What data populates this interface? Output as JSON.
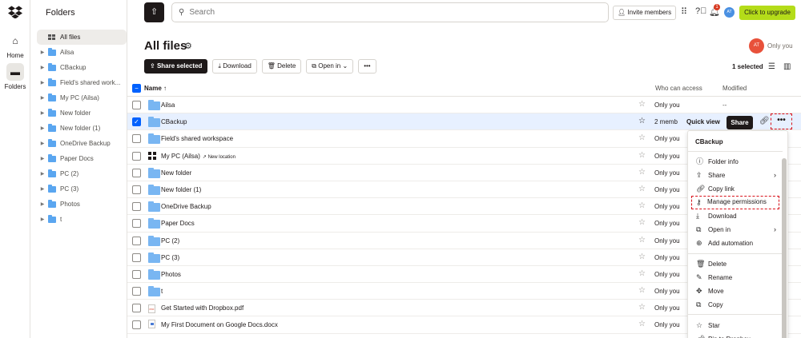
{
  "rail": {
    "items": [
      {
        "label": "Home"
      },
      {
        "label": "Folders"
      }
    ]
  },
  "folders_panel": {
    "title": "Folders",
    "items": [
      {
        "label": "All files"
      },
      {
        "label": "Ailsa"
      },
      {
        "label": "CBackup"
      },
      {
        "label": "Field's shared work..."
      },
      {
        "label": "My PC (Ailsa)"
      },
      {
        "label": "New folder"
      },
      {
        "label": "New folder (1)"
      },
      {
        "label": "OneDrive Backup"
      },
      {
        "label": "Paper Docs"
      },
      {
        "label": "PC (2)"
      },
      {
        "label": "PC (3)"
      },
      {
        "label": "Photos"
      },
      {
        "label": "t"
      }
    ]
  },
  "topbar": {
    "search_placeholder": "Search",
    "invite_label": "Invite members",
    "notification_count": "1",
    "avatar_initials": "AT",
    "upgrade_label": "Click to upgrade"
  },
  "header": {
    "title": "All files",
    "owner_initials": "AT",
    "owner_text": "Only you"
  },
  "actions": {
    "share_selected": "Share selected",
    "download": "Download",
    "delete": "Delete",
    "open_in": "Open in",
    "selected_count": "1 selected"
  },
  "table": {
    "columns": {
      "name": "Name",
      "access": "Who can access",
      "modified": "Modified"
    },
    "rows": [
      {
        "name": "Ailsa",
        "access": "Only you",
        "modified": "--",
        "type": "folder"
      },
      {
        "name": "CBackup",
        "access": "2 memb",
        "modified": "",
        "type": "folder-shared",
        "selected": true
      },
      {
        "name": "Field's shared workspace",
        "access": "Only you",
        "modified": "",
        "type": "folder-shared"
      },
      {
        "name": "My PC (Ailsa)",
        "access": "Only you",
        "modified": "",
        "type": "windows",
        "badge": "New location"
      },
      {
        "name": "New folder",
        "access": "Only you",
        "modified": "",
        "type": "folder"
      },
      {
        "name": "New folder (1)",
        "access": "Only you",
        "modified": "",
        "type": "folder"
      },
      {
        "name": "OneDrive Backup",
        "access": "Only you",
        "modified": "",
        "type": "folder"
      },
      {
        "name": "Paper Docs",
        "access": "Only you",
        "modified": "",
        "type": "folder"
      },
      {
        "name": "PC (2)",
        "access": "Only you",
        "modified": "",
        "type": "folder"
      },
      {
        "name": "PC (3)",
        "access": "Only you",
        "modified": "",
        "type": "folder"
      },
      {
        "name": "Photos",
        "access": "Only you",
        "modified": "",
        "type": "folder"
      },
      {
        "name": "t",
        "access": "Only you",
        "modified": "",
        "type": "folder"
      },
      {
        "name": "Get Started with Dropbox.pdf",
        "access": "Only you",
        "modified": "",
        "type": "pdf"
      },
      {
        "name": "My First Document on Google Docs.docx",
        "access": "Only you",
        "modified": "",
        "type": "gdoc"
      }
    ]
  },
  "row_actions": {
    "quick_view": "Quick view",
    "share": "Share",
    "more": "•••"
  },
  "context_menu": {
    "title": "CBackup",
    "items": [
      {
        "label": "Folder info",
        "icon": "info-icon"
      },
      {
        "label": "Share",
        "icon": "share-icon"
      },
      {
        "label": "Copy link",
        "icon": "link-icon"
      },
      {
        "label": "Manage permissions",
        "icon": "permissions-icon"
      },
      {
        "label": "Download",
        "icon": "download-icon"
      },
      {
        "label": "Open in",
        "icon": "open-in-icon"
      },
      {
        "label": "Add automation",
        "icon": "automation-icon"
      },
      {
        "label": "Delete",
        "icon": "trash-icon"
      },
      {
        "label": "Rename",
        "icon": "rename-icon"
      },
      {
        "label": "Move",
        "icon": "move-icon"
      },
      {
        "label": "Copy",
        "icon": "copy-icon"
      },
      {
        "label": "Star",
        "icon": "star-icon"
      },
      {
        "label": "Pin to Dropbox",
        "icon": "pin-icon"
      }
    ]
  },
  "colors": {
    "accent": "#0061fe",
    "upgrade": "#b4dc19",
    "highlight_dashed": "#d8121b",
    "selected_row": "#e7f0ff"
  }
}
